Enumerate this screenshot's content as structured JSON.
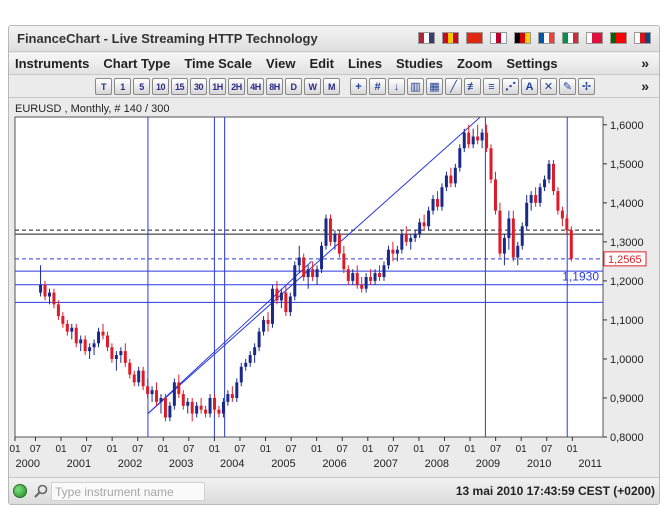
{
  "window": {
    "title": "FinanceChart - Live Streaming HTTP Technology"
  },
  "flags": [
    {
      "name": "us-flag",
      "colors": [
        "#b22234",
        "#ffffff",
        "#3c3b6e"
      ]
    },
    {
      "name": "es-flag",
      "colors": [
        "#c60b1e",
        "#ffc400",
        "#c60b1e"
      ]
    },
    {
      "name": "cn-flag",
      "colors": [
        "#de2910",
        "#de2910",
        "#de2910"
      ]
    },
    {
      "name": "jp-flag",
      "colors": [
        "#ffffff",
        "#bc002d",
        "#ffffff"
      ]
    },
    {
      "name": "de-flag",
      "colors": [
        "#000000",
        "#dd0000",
        "#ffce00"
      ]
    },
    {
      "name": "fr-flag",
      "colors": [
        "#0055a4",
        "#ffffff",
        "#ef4135"
      ]
    },
    {
      "name": "it-flag",
      "colors": [
        "#009246",
        "#ffffff",
        "#ce2b37"
      ]
    },
    {
      "name": "pl-flag",
      "colors": [
        "#ffffff",
        "#dc143c",
        "#dc143c"
      ]
    },
    {
      "name": "pt-flag",
      "colors": [
        "#006600",
        "#ff0000",
        "#ff0000"
      ]
    },
    {
      "name": "cz-flag",
      "colors": [
        "#ffffff",
        "#d7141a",
        "#11457e"
      ]
    }
  ],
  "menu": [
    "Instruments",
    "Chart Type",
    "Time Scale",
    "View",
    "Edit",
    "Lines",
    "Studies",
    "Zoom",
    "Settings"
  ],
  "menu_more": "»",
  "toolbar": {
    "timeframes": [
      "T",
      "1",
      "5",
      "10",
      "15",
      "30",
      "1H",
      "2H",
      "4H",
      "8H",
      "D",
      "W",
      "M"
    ],
    "tools": [
      {
        "name": "crosshair-icon",
        "glyph": "+"
      },
      {
        "name": "grid-icon",
        "glyph": "#"
      },
      {
        "name": "arrow-down-icon",
        "glyph": "↓"
      },
      {
        "name": "bar-chart-icon",
        "glyph": "▥"
      },
      {
        "name": "bar-chart-red-icon",
        "glyph": "▦"
      },
      {
        "name": "trend-line-icon",
        "glyph": "╱"
      },
      {
        "name": "channel-icon",
        "glyph": "≢"
      },
      {
        "name": "fibonacci-icon",
        "glyph": "≡"
      },
      {
        "name": "fan-icon",
        "glyph": "⋰"
      },
      {
        "name": "text-icon",
        "glyph": "A"
      },
      {
        "name": "erase-icon",
        "glyph": "✕"
      },
      {
        "name": "pencil-icon",
        "glyph": "✎"
      },
      {
        "name": "pin-icon",
        "glyph": "✢"
      }
    ],
    "more": "»"
  },
  "chart_data": {
    "type": "candlestick",
    "title": "EURUSD , Monthly, # 140 / 300",
    "ylim": [
      0.8,
      1.62
    ],
    "y_ticks": [
      "1,6000",
      "1,5000",
      "1,4000",
      "1,3000",
      "1,2000",
      "1,1000",
      "1,0000",
      "0,9000",
      "0,8000"
    ],
    "y_tick_values": [
      1.6,
      1.5,
      1.4,
      1.3,
      1.2,
      1.1,
      1.0,
      0.9,
      0.8
    ],
    "x_range": [
      1999.5,
      2011.0
    ],
    "x_tick_labels": [
      "01",
      "07",
      "01",
      "07",
      "01",
      "07",
      "01",
      "07",
      "01",
      "07",
      "01",
      "07",
      "01",
      "07",
      "01",
      "07",
      "01",
      "07",
      "01",
      "07",
      "01",
      "07",
      "01"
    ],
    "x_tick_values": [
      1999.5,
      1999.9,
      2000.4,
      2000.9,
      2001.4,
      2001.9,
      2002.4,
      2002.9,
      2003.4,
      2003.9,
      2004.4,
      2004.9,
      2005.4,
      2005.9,
      2006.4,
      2006.9,
      2007.4,
      2007.9,
      2008.4,
      2008.9,
      2009.4,
      2009.9,
      2010.4
    ],
    "x_year_labels": [
      "2000",
      "2001",
      "2002",
      "2003",
      "2004",
      "2005",
      "2006",
      "2007",
      "2008",
      "2009",
      "2010",
      "2011"
    ],
    "x_year_values": [
      1999.75,
      2000.75,
      2001.75,
      2002.75,
      2003.75,
      2004.75,
      2005.75,
      2006.75,
      2007.75,
      2008.75,
      2009.75,
      2010.75
    ],
    "price_labels": [
      {
        "label": "1,2565",
        "value": 1.2565,
        "boxed": true,
        "color": "#e0202a"
      },
      {
        "label": "1,1930",
        "value": 1.193,
        "boxed": false,
        "color": "#2a3adf"
      }
    ],
    "horizontal_lines": [
      {
        "value": 1.33,
        "style": "dashed"
      },
      {
        "value": 1.32,
        "style": "solid"
      },
      {
        "value": 1.2565,
        "style": "dashed"
      },
      {
        "value": 1.225,
        "style": "solid"
      },
      {
        "value": 1.19,
        "style": "solid"
      },
      {
        "value": 1.145,
        "style": "solid"
      }
    ],
    "vertical_lines": [
      2002.1,
      2003.4,
      2003.6,
      2008.7,
      2010.3
    ],
    "trend_lines": [
      {
        "from": [
          2002.1,
          0.86
        ],
        "to": [
          2008.6,
          1.62
        ]
      },
      {
        "from": [
          2002.1,
          0.86
        ],
        "to": [
          2005.3,
          1.25
        ]
      }
    ],
    "colors": {
      "up": "#1a2a8a",
      "down": "#dd1c2a",
      "grid": "#333333",
      "line": "#2a3adf"
    },
    "candles_ohlc": [
      [
        1.17,
        1.24,
        1.16,
        1.19
      ],
      [
        1.19,
        1.2,
        1.15,
        1.16
      ],
      [
        1.16,
        1.18,
        1.14,
        1.17
      ],
      [
        1.17,
        1.18,
        1.13,
        1.14
      ],
      [
        1.14,
        1.15,
        1.1,
        1.11
      ],
      [
        1.11,
        1.12,
        1.08,
        1.09
      ],
      [
        1.09,
        1.1,
        1.06,
        1.07
      ],
      [
        1.07,
        1.09,
        1.05,
        1.08
      ],
      [
        1.08,
        1.09,
        1.03,
        1.04
      ],
      [
        1.04,
        1.06,
        1.02,
        1.05
      ],
      [
        1.05,
        1.06,
        1.01,
        1.02
      ],
      [
        1.02,
        1.04,
        1.0,
        1.03
      ],
      [
        1.03,
        1.05,
        1.01,
        1.04
      ],
      [
        1.04,
        1.08,
        1.03,
        1.07
      ],
      [
        1.07,
        1.09,
        1.05,
        1.06
      ],
      [
        1.06,
        1.07,
        1.02,
        1.03
      ],
      [
        1.03,
        1.04,
        0.99,
        1.0
      ],
      [
        1.0,
        1.02,
        0.97,
        1.01
      ],
      [
        1.01,
        1.03,
        0.99,
        1.02
      ],
      [
        1.02,
        1.04,
        0.98,
        0.99
      ],
      [
        0.99,
        1.0,
        0.95,
        0.96
      ],
      [
        0.96,
        0.97,
        0.93,
        0.94
      ],
      [
        0.94,
        0.98,
        0.93,
        0.97
      ],
      [
        0.97,
        0.98,
        0.92,
        0.93
      ],
      [
        0.93,
        0.95,
        0.9,
        0.91
      ],
      [
        0.91,
        0.93,
        0.89,
        0.92
      ],
      [
        0.92,
        0.94,
        0.88,
        0.89
      ],
      [
        0.89,
        0.91,
        0.86,
        0.9
      ],
      [
        0.9,
        0.91,
        0.84,
        0.85
      ],
      [
        0.85,
        0.89,
        0.84,
        0.88
      ],
      [
        0.88,
        0.95,
        0.87,
        0.94
      ],
      [
        0.94,
        0.96,
        0.9,
        0.91
      ],
      [
        0.91,
        0.92,
        0.87,
        0.88
      ],
      [
        0.88,
        0.9,
        0.86,
        0.89
      ],
      [
        0.89,
        0.9,
        0.84,
        0.86
      ],
      [
        0.86,
        0.89,
        0.85,
        0.88
      ],
      [
        0.88,
        0.9,
        0.86,
        0.87
      ],
      [
        0.87,
        0.88,
        0.85,
        0.86
      ],
      [
        0.86,
        0.91,
        0.85,
        0.9
      ],
      [
        0.9,
        0.91,
        0.86,
        0.87
      ],
      [
        0.87,
        0.88,
        0.85,
        0.86
      ],
      [
        0.86,
        0.9,
        0.85,
        0.89
      ],
      [
        0.89,
        0.92,
        0.88,
        0.91
      ],
      [
        0.91,
        0.93,
        0.89,
        0.9
      ],
      [
        0.9,
        0.95,
        0.89,
        0.94
      ],
      [
        0.94,
        0.99,
        0.93,
        0.98
      ],
      [
        0.98,
        1.0,
        0.97,
        0.99
      ],
      [
        0.99,
        1.02,
        0.98,
        1.01
      ],
      [
        1.01,
        1.04,
        0.99,
        1.03
      ],
      [
        1.03,
        1.08,
        1.02,
        1.07
      ],
      [
        1.07,
        1.11,
        1.06,
        1.1
      ],
      [
        1.1,
        1.12,
        1.07,
        1.09
      ],
      [
        1.09,
        1.19,
        1.08,
        1.18
      ],
      [
        1.18,
        1.2,
        1.14,
        1.15
      ],
      [
        1.15,
        1.18,
        1.13,
        1.17
      ],
      [
        1.17,
        1.19,
        1.11,
        1.12
      ],
      [
        1.12,
        1.17,
        1.11,
        1.16
      ],
      [
        1.16,
        1.25,
        1.15,
        1.24
      ],
      [
        1.24,
        1.29,
        1.22,
        1.26
      ],
      [
        1.26,
        1.27,
        1.2,
        1.21
      ],
      [
        1.21,
        1.24,
        1.18,
        1.23
      ],
      [
        1.23,
        1.25,
        1.2,
        1.21
      ],
      [
        1.21,
        1.24,
        1.19,
        1.23
      ],
      [
        1.23,
        1.3,
        1.22,
        1.29
      ],
      [
        1.29,
        1.37,
        1.28,
        1.36
      ],
      [
        1.36,
        1.37,
        1.29,
        1.3
      ],
      [
        1.3,
        1.33,
        1.28,
        1.32
      ],
      [
        1.32,
        1.33,
        1.26,
        1.27
      ],
      [
        1.27,
        1.29,
        1.22,
        1.23
      ],
      [
        1.23,
        1.24,
        1.19,
        1.2
      ],
      [
        1.2,
        1.23,
        1.19,
        1.22
      ],
      [
        1.22,
        1.24,
        1.18,
        1.19
      ],
      [
        1.19,
        1.21,
        1.17,
        1.18
      ],
      [
        1.18,
        1.22,
        1.17,
        1.21
      ],
      [
        1.21,
        1.23,
        1.19,
        1.2
      ],
      [
        1.2,
        1.23,
        1.19,
        1.22
      ],
      [
        1.22,
        1.24,
        1.2,
        1.21
      ],
      [
        1.21,
        1.25,
        1.2,
        1.24
      ],
      [
        1.24,
        1.29,
        1.23,
        1.28
      ],
      [
        1.28,
        1.3,
        1.25,
        1.27
      ],
      [
        1.27,
        1.29,
        1.25,
        1.28
      ],
      [
        1.28,
        1.33,
        1.27,
        1.32
      ],
      [
        1.32,
        1.34,
        1.29,
        1.3
      ],
      [
        1.3,
        1.32,
        1.28,
        1.31
      ],
      [
        1.31,
        1.33,
        1.3,
        1.32
      ],
      [
        1.32,
        1.36,
        1.31,
        1.35
      ],
      [
        1.35,
        1.37,
        1.33,
        1.34
      ],
      [
        1.34,
        1.39,
        1.33,
        1.38
      ],
      [
        1.38,
        1.42,
        1.37,
        1.41
      ],
      [
        1.41,
        1.43,
        1.38,
        1.39
      ],
      [
        1.39,
        1.45,
        1.38,
        1.44
      ],
      [
        1.44,
        1.48,
        1.43,
        1.47
      ],
      [
        1.47,
        1.49,
        1.44,
        1.45
      ],
      [
        1.45,
        1.5,
        1.44,
        1.49
      ],
      [
        1.49,
        1.55,
        1.48,
        1.54
      ],
      [
        1.54,
        1.59,
        1.53,
        1.58
      ],
      [
        1.58,
        1.6,
        1.54,
        1.55
      ],
      [
        1.55,
        1.59,
        1.54,
        1.57
      ],
      [
        1.57,
        1.6,
        1.55,
        1.56
      ],
      [
        1.56,
        1.59,
        1.54,
        1.58
      ],
      [
        1.58,
        1.6,
        1.53,
        1.54
      ],
      [
        1.54,
        1.55,
        1.45,
        1.46
      ],
      [
        1.46,
        1.48,
        1.37,
        1.38
      ],
      [
        1.38,
        1.4,
        1.26,
        1.27
      ],
      [
        1.27,
        1.32,
        1.24,
        1.31
      ],
      [
        1.31,
        1.38,
        1.28,
        1.36
      ],
      [
        1.36,
        1.38,
        1.25,
        1.26
      ],
      [
        1.26,
        1.3,
        1.24,
        1.29
      ],
      [
        1.29,
        1.35,
        1.28,
        1.34
      ],
      [
        1.34,
        1.42,
        1.33,
        1.4
      ],
      [
        1.4,
        1.43,
        1.38,
        1.42
      ],
      [
        1.42,
        1.44,
        1.39,
        1.4
      ],
      [
        1.4,
        1.45,
        1.39,
        1.44
      ],
      [
        1.44,
        1.47,
        1.43,
        1.46
      ],
      [
        1.46,
        1.51,
        1.45,
        1.5
      ],
      [
        1.5,
        1.51,
        1.42,
        1.43
      ],
      [
        1.43,
        1.44,
        1.37,
        1.38
      ],
      [
        1.38,
        1.39,
        1.34,
        1.36
      ],
      [
        1.36,
        1.37,
        1.32,
        1.33
      ],
      [
        1.33,
        1.34,
        1.25,
        1.2565
      ]
    ]
  },
  "status": {
    "search_placeholder": "Type instrument name",
    "timestamp": "13 mai 2010 17:43:59  CEST (+0200)"
  }
}
